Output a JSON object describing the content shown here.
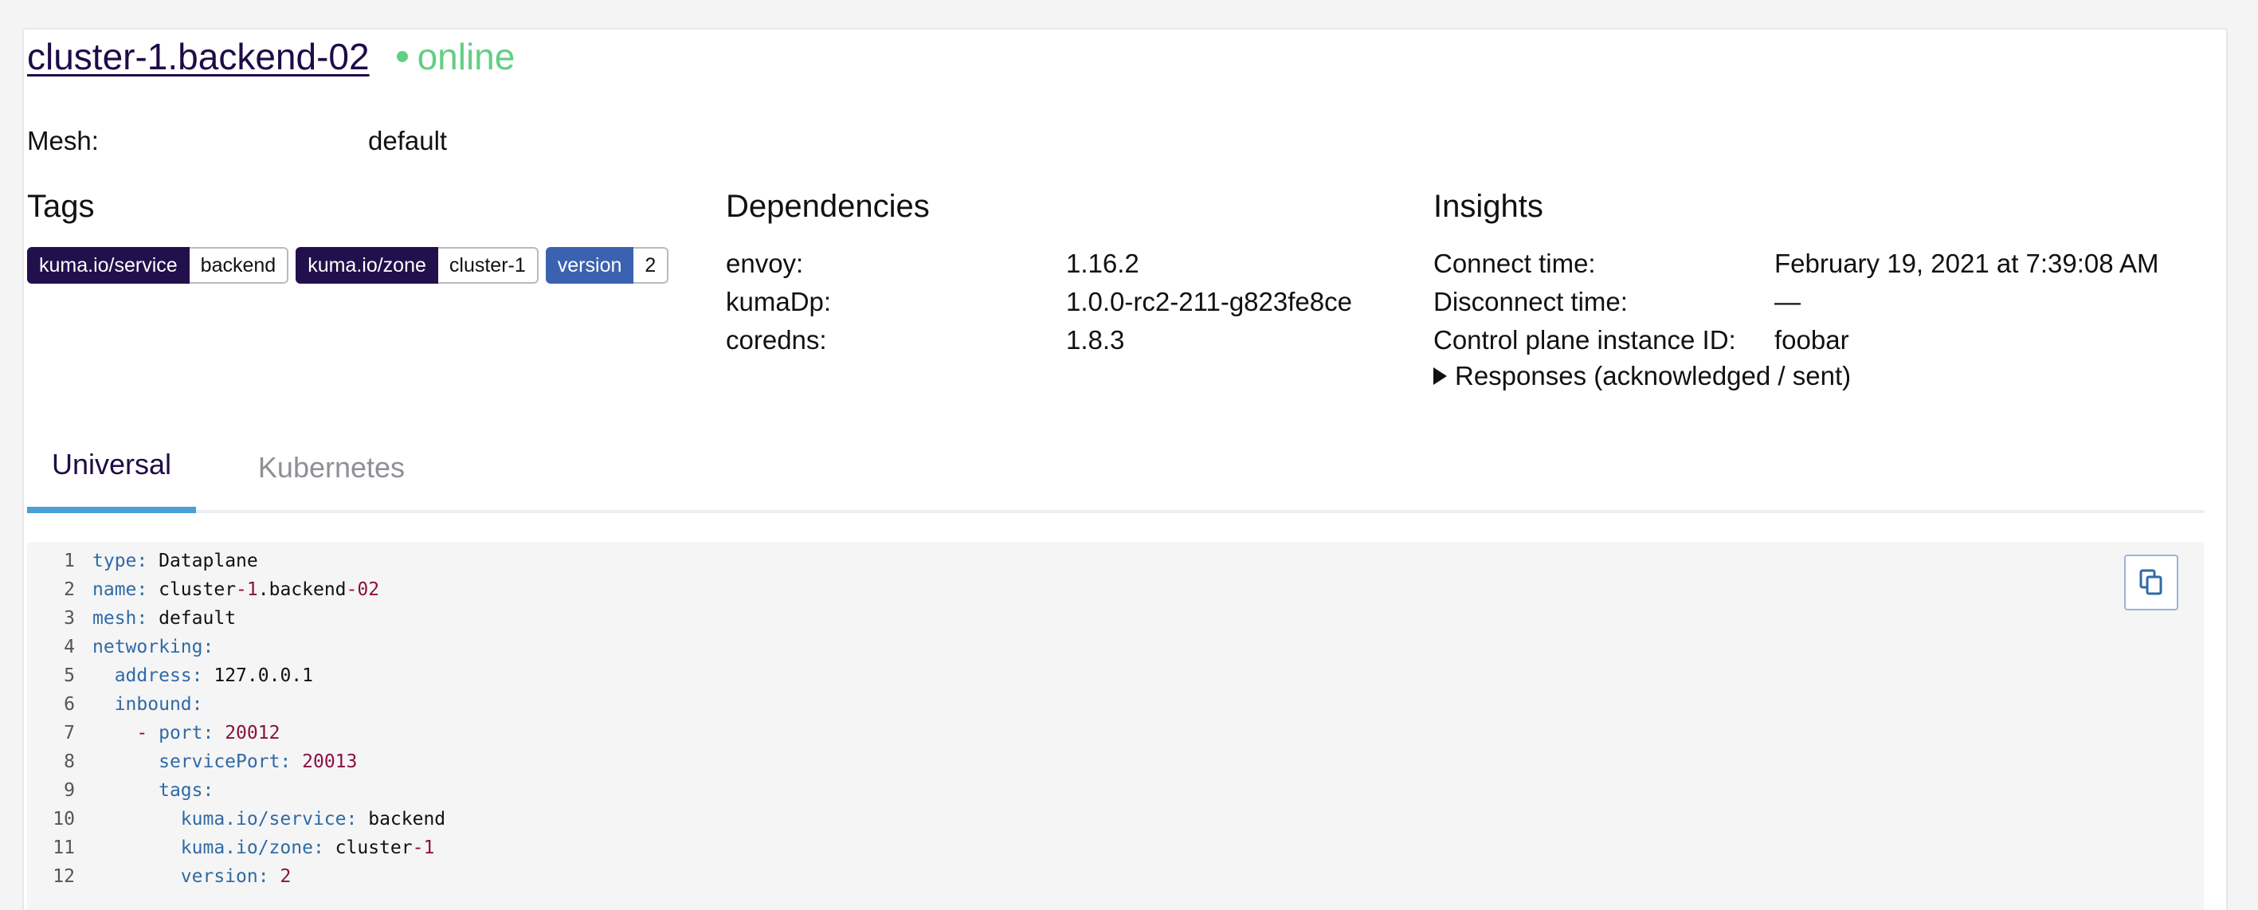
{
  "header": {
    "title": "cluster-1.backend-02",
    "status": "online"
  },
  "mesh": {
    "label": "Mesh:",
    "value": "default"
  },
  "tags": {
    "title": "Tags",
    "items": [
      {
        "key": "kuma.io/service",
        "value": "backend"
      },
      {
        "key": "kuma.io/zone",
        "value": "cluster-1"
      },
      {
        "key": "version",
        "value": "2"
      }
    ]
  },
  "dependencies": {
    "title": "Dependencies",
    "items": [
      {
        "label": "envoy:",
        "value": "1.16.2"
      },
      {
        "label": "kumaDp:",
        "value": "1.0.0-rc2-211-g823fe8ce"
      },
      {
        "label": "coredns:",
        "value": "1.8.3"
      }
    ]
  },
  "insights": {
    "title": "Insights",
    "items": [
      {
        "label": "Connect time:",
        "value": "February 19, 2021 at 7:39:08 AM"
      },
      {
        "label": "Disconnect time:",
        "value": "—"
      },
      {
        "label": "Control plane instance ID:",
        "value": "foobar"
      }
    ],
    "responses_label": "Responses (acknowledged / sent)"
  },
  "tabs": [
    {
      "label": "Universal",
      "active": true
    },
    {
      "label": "Kubernetes",
      "active": false
    }
  ],
  "code": {
    "lines": [
      {
        "n": "1",
        "indent": "",
        "dash": "",
        "key": "type",
        "value": "Dataplane",
        "vtype": "str"
      },
      {
        "n": "2",
        "indent": "",
        "dash": "",
        "key": "name",
        "value": "cluster-1.backend-02",
        "vtype": "str"
      },
      {
        "n": "3",
        "indent": "",
        "dash": "",
        "key": "mesh",
        "value": "default",
        "vtype": "str"
      },
      {
        "n": "4",
        "indent": "",
        "dash": "",
        "key": "networking",
        "value": "",
        "vtype": "str"
      },
      {
        "n": "5",
        "indent": "  ",
        "dash": "",
        "key": "address",
        "value": "127.0.0.1",
        "vtype": "str"
      },
      {
        "n": "6",
        "indent": "  ",
        "dash": "",
        "key": "inbound",
        "value": "",
        "vtype": "str"
      },
      {
        "n": "7",
        "indent": "    ",
        "dash": "- ",
        "key": "port",
        "value": "20012",
        "vtype": "num"
      },
      {
        "n": "8",
        "indent": "      ",
        "dash": "",
        "key": "servicePort",
        "value": "20013",
        "vtype": "num"
      },
      {
        "n": "9",
        "indent": "      ",
        "dash": "",
        "key": "tags",
        "value": "",
        "vtype": "str"
      },
      {
        "n": "10",
        "indent": "        ",
        "dash": "",
        "key": "kuma.io/service",
        "value": "backend",
        "vtype": "str"
      },
      {
        "n": "11",
        "indent": "        ",
        "dash": "",
        "key": "kuma.io/zone",
        "value": "cluster-1",
        "vtype": "str"
      },
      {
        "n": "12",
        "indent": "        ",
        "dash": "",
        "key": "version",
        "value": "2",
        "vtype": "num"
      }
    ]
  },
  "colors": {
    "title": "#1e0b47",
    "online": "#61cf82",
    "tag_dark": "#22104c",
    "tag_blue": "#3b62b0",
    "tab_active_underline": "#4a9fd8",
    "yaml_key": "#2f6aa6",
    "yaml_number": "#8b1040"
  },
  "icons": {
    "copy": "copy-icon",
    "status": "status-dot-icon",
    "disclosure": "triangle-right-icon"
  }
}
